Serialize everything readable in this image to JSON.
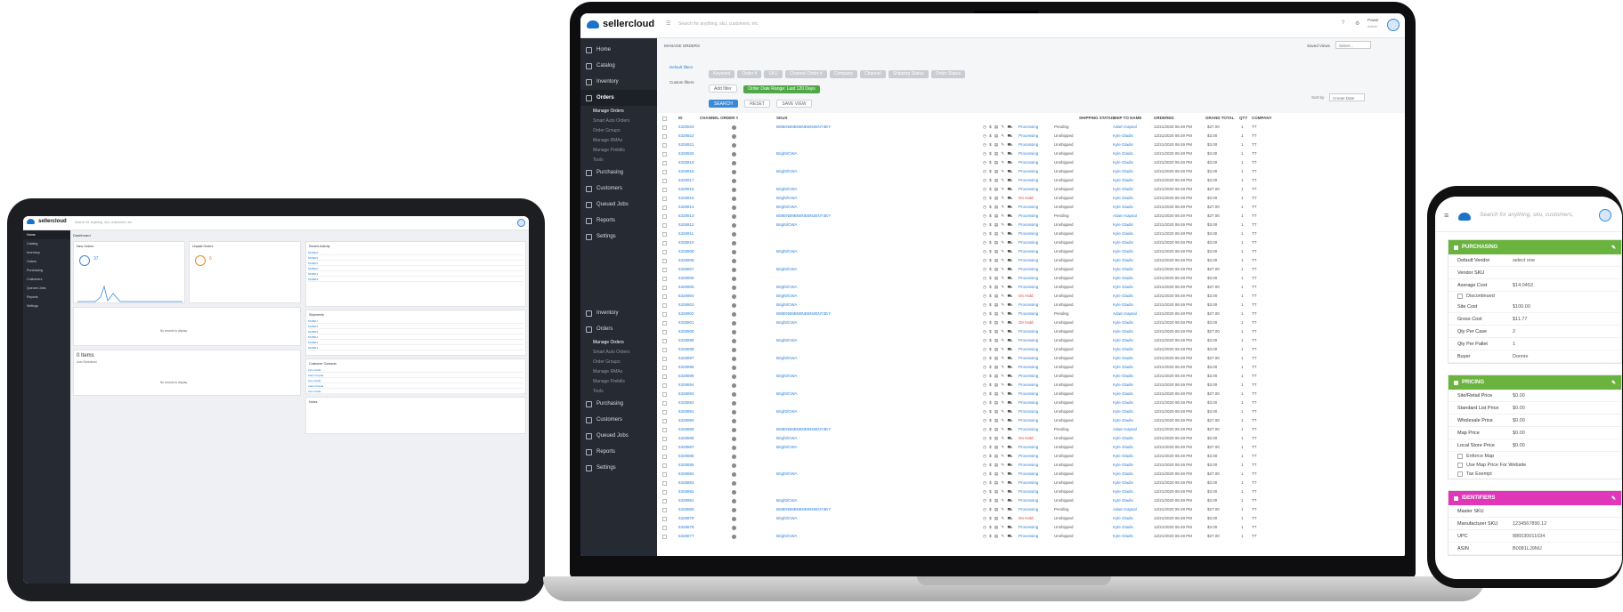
{
  "laptop": {
    "brand": "sellercloud",
    "search_placeholder": "Search for anything, sku, customers, etc",
    "user_name": "Power",
    "user_sub": "Admin",
    "sidebar": [
      {
        "label": "Home"
      },
      {
        "label": "Catalog"
      },
      {
        "label": "Inventory"
      },
      {
        "label": "Orders",
        "active": true,
        "subs": [
          "Manage Orders",
          "Smart Auto Orders",
          "Order Groups",
          "Manage RMAs",
          "Manage Prebills",
          "Tools"
        ]
      },
      {
        "label": "Purchasing"
      },
      {
        "label": "Customers"
      },
      {
        "label": "Queued Jobs"
      },
      {
        "label": "Reports"
      },
      {
        "label": "Settings"
      }
    ],
    "sidebar_repeat": [
      {
        "label": "Inventory"
      },
      {
        "label": "Orders",
        "subs": [
          "Manage Orders",
          "Smart Auto Orders",
          "Order Groups",
          "Manage RMAs",
          "Manage Prebills",
          "Tools"
        ]
      },
      {
        "label": "Purchasing"
      },
      {
        "label": "Customers"
      },
      {
        "label": "Queued Jobs"
      },
      {
        "label": "Reports"
      },
      {
        "label": "Settings"
      }
    ],
    "page_title": "MANAGE ORDERS",
    "saved_views_label": "Saved Views",
    "saved_views_value": "Select...",
    "default_filters_label": "Default filters",
    "filter_chips": [
      "Keyword",
      "Order #",
      "SKU",
      "Channel Order #",
      "Company",
      "Channel",
      "Shipping Status",
      "Order Status"
    ],
    "custom_filters_label": "Custom filters",
    "add_filter": "Add filter",
    "date_chip": "Order Date Range: Last 120 Days",
    "search_btn": "SEARCH",
    "reset_btn": "RESET",
    "save_view_btn": "SAVE VIEW",
    "sort_label": "Sort by",
    "sort_value": "Create Date",
    "columns": [
      "ID",
      "CHANNEL ORDER #",
      "SKUS",
      "SHIPPING STATUS",
      "SHIP TO NAME",
      "ORDERED",
      "GRAND TOTAL",
      "QTY",
      "COMPANY"
    ],
    "rows": [
      [
        "5328923",
        "",
        "B08ENB9BN8NEBN3ENY3EY",
        "Processing",
        "Pending",
        "Adam Kapsal",
        "12/21/2020 06:49 PM",
        "$27.00",
        "1",
        "TT"
      ],
      [
        "5328922",
        "",
        "",
        "Processing",
        "Unshipped",
        "Kyle Gladis",
        "12/21/2020 06:49 PM",
        "$3.00",
        "1",
        "TT"
      ],
      [
        "5328921",
        "",
        "",
        "Processing",
        "Unshipped",
        "Kyle Gladis",
        "12/21/2020 06:49 PM",
        "$3.00",
        "1",
        "TT"
      ],
      [
        "5328920",
        "",
        "Bright/CWA",
        "Processing",
        "Unshipped",
        "Kyle Gladis",
        "12/21/2020 06:49 PM",
        "$3.00",
        "1",
        "TT"
      ],
      [
        "5328919",
        "",
        "",
        "Processing",
        "Unshipped",
        "Kyle Gladis",
        "12/21/2020 06:49 PM",
        "$3.00",
        "1",
        "TT"
      ],
      [
        "5328918",
        "",
        "Bright/CWA",
        "Processing",
        "Unshipped",
        "Kyle Gladis",
        "12/21/2020 06:49 PM",
        "$3.00",
        "1",
        "TT"
      ],
      [
        "5328917",
        "",
        "",
        "Processing",
        "Unshipped",
        "Kyle Gladis",
        "12/21/2020 06:49 PM",
        "$3.00",
        "1",
        "TT"
      ],
      [
        "5328916",
        "",
        "Bright/CWA",
        "Processing",
        "Unshipped",
        "Kyle Gladis",
        "12/21/2020 06:49 PM",
        "$27.00",
        "1",
        "TT"
      ],
      [
        "5328915",
        "",
        "Bright/CWA",
        "On Hold",
        "Unshipped",
        "Kyle Gladis",
        "12/21/2020 06:49 PM",
        "$3.00",
        "1",
        "TT"
      ],
      [
        "5328914",
        "",
        "Bright/CWA",
        "Processing",
        "Unshipped",
        "Kyle Gladis",
        "12/21/2020 06:49 PM",
        "$27.00",
        "1",
        "TT"
      ],
      [
        "5328913",
        "",
        "B08ENB9BN8NEBN3ENY3EY",
        "Processing",
        "Pending",
        "Adam Kapsal",
        "12/21/2020 06:49 PM",
        "$27.00",
        "1",
        "TT"
      ],
      [
        "5328912",
        "",
        "Bright/CWA",
        "Processing",
        "Unshipped",
        "Kyle Gladis",
        "12/21/2020 06:49 PM",
        "$3.00",
        "1",
        "TT"
      ],
      [
        "5328911",
        "",
        "",
        "Processing",
        "Unshipped",
        "Kyle Gladis",
        "12/21/2020 06:49 PM",
        "$3.00",
        "1",
        "TT"
      ],
      [
        "5328910",
        "",
        "",
        "Processing",
        "Unshipped",
        "Kyle Gladis",
        "12/21/2020 06:49 PM",
        "$3.00",
        "1",
        "TT"
      ],
      [
        "5328909",
        "",
        "Bright/CWA",
        "Processing",
        "Unshipped",
        "Kyle Gladis",
        "12/21/2020 06:49 PM",
        "$3.00",
        "1",
        "TT"
      ],
      [
        "5328908",
        "",
        "",
        "Processing",
        "Unshipped",
        "Kyle Gladis",
        "12/21/2020 06:49 PM",
        "$3.00",
        "1",
        "TT"
      ],
      [
        "5328907",
        "",
        "Bright/CWA",
        "Processing",
        "Unshipped",
        "Kyle Gladis",
        "12/21/2020 06:49 PM",
        "$27.00",
        "1",
        "TT"
      ],
      [
        "5328906",
        "",
        "",
        "Processing",
        "Unshipped",
        "Kyle Gladis",
        "12/21/2020 06:49 PM",
        "$3.00",
        "1",
        "TT"
      ],
      [
        "5328905",
        "",
        "Bright/CWA",
        "Processing",
        "Unshipped",
        "Kyle Gladis",
        "12/21/2020 06:49 PM",
        "$27.00",
        "1",
        "TT"
      ],
      [
        "5328904",
        "",
        "Bright/CWA",
        "On Hold",
        "Unshipped",
        "Kyle Gladis",
        "12/21/2020 06:49 PM",
        "$3.00",
        "1",
        "TT"
      ],
      [
        "5328903",
        "",
        "Bright/CWA",
        "Processing",
        "Unshipped",
        "Kyle Gladis",
        "12/21/2020 06:49 PM",
        "$3.00",
        "1",
        "TT"
      ],
      [
        "5328902",
        "",
        "B08ENB9BN8NEBN3ENY3EY",
        "Processing",
        "Pending",
        "Adam Kapsal",
        "12/21/2020 06:49 PM",
        "$27.00",
        "1",
        "TT"
      ],
      [
        "5328901",
        "",
        "Bright/CWA",
        "On Hold",
        "Unshipped",
        "Kyle Gladis",
        "12/21/2020 06:49 PM",
        "$3.00",
        "1",
        "TT"
      ],
      [
        "5328900",
        "",
        "",
        "Processing",
        "Unshipped",
        "Kyle Gladis",
        "12/21/2020 06:49 PM",
        "$27.00",
        "1",
        "TT"
      ],
      [
        "5328899",
        "",
        "Bright/CWA",
        "Processing",
        "Unshipped",
        "Kyle Gladis",
        "12/21/2020 06:49 PM",
        "$3.00",
        "1",
        "TT"
      ],
      [
        "5328898",
        "",
        "",
        "Processing",
        "Unshipped",
        "Kyle Gladis",
        "12/21/2020 06:49 PM",
        "$3.00",
        "1",
        "TT"
      ],
      [
        "5328897",
        "",
        "Bright/CWA",
        "Processing",
        "Unshipped",
        "Kyle Gladis",
        "12/21/2020 06:49 PM",
        "$27.00",
        "1",
        "TT"
      ],
      [
        "5328896",
        "",
        "",
        "Processing",
        "Unshipped",
        "Kyle Gladis",
        "12/21/2020 06:49 PM",
        "$3.00",
        "1",
        "TT"
      ],
      [
        "5328895",
        "",
        "Bright/CWA",
        "Processing",
        "Unshipped",
        "Kyle Gladis",
        "12/21/2020 06:49 PM",
        "$3.00",
        "1",
        "TT"
      ],
      [
        "5328894",
        "",
        "",
        "Processing",
        "Unshipped",
        "Kyle Gladis",
        "12/21/2020 06:49 PM",
        "$3.00",
        "1",
        "TT"
      ],
      [
        "5328893",
        "",
        "Bright/CWA",
        "Processing",
        "Unshipped",
        "Kyle Gladis",
        "12/21/2020 06:49 PM",
        "$27.00",
        "1",
        "TT"
      ],
      [
        "5328892",
        "",
        "",
        "Processing",
        "Unshipped",
        "Kyle Gladis",
        "12/21/2020 06:49 PM",
        "$3.00",
        "1",
        "TT"
      ],
      [
        "5328891",
        "",
        "Bright/CWA",
        "Processing",
        "Unshipped",
        "Kyle Gladis",
        "12/21/2020 06:49 PM",
        "$3.00",
        "1",
        "TT"
      ],
      [
        "5328890",
        "",
        "",
        "Processing",
        "Unshipped",
        "Kyle Gladis",
        "12/21/2020 06:49 PM",
        "$27.00",
        "1",
        "TT"
      ],
      [
        "5328889",
        "",
        "B08ENB9BN8NEBN3ENY3EY",
        "Processing",
        "Pending",
        "Adam Kapsal",
        "12/21/2020 06:49 PM",
        "$27.00",
        "1",
        "TT"
      ],
      [
        "5328888",
        "",
        "Bright/CWA",
        "On Hold",
        "Unshipped",
        "Kyle Gladis",
        "12/21/2020 06:49 PM",
        "$3.00",
        "1",
        "TT"
      ],
      [
        "5328887",
        "",
        "Bright/CWA",
        "Processing",
        "Unshipped",
        "Kyle Gladis",
        "12/21/2020 06:49 PM",
        "$27.00",
        "1",
        "TT"
      ],
      [
        "5328886",
        "",
        "",
        "Processing",
        "Unshipped",
        "Kyle Gladis",
        "12/21/2020 06:49 PM",
        "$3.00",
        "1",
        "TT"
      ],
      [
        "5328885",
        "",
        "",
        "Processing",
        "Unshipped",
        "Kyle Gladis",
        "12/21/2020 06:49 PM",
        "$3.00",
        "1",
        "TT"
      ],
      [
        "5328884",
        "",
        "Bright/CWA",
        "Processing",
        "Unshipped",
        "Kyle Gladis",
        "12/21/2020 06:49 PM",
        "$27.00",
        "1",
        "TT"
      ],
      [
        "5328883",
        "",
        "",
        "Processing",
        "Unshipped",
        "Kyle Gladis",
        "12/21/2020 06:49 PM",
        "$3.00",
        "1",
        "TT"
      ],
      [
        "5328882",
        "",
        "",
        "Processing",
        "Unshipped",
        "Kyle Gladis",
        "12/21/2020 06:49 PM",
        "$3.00",
        "1",
        "TT"
      ],
      [
        "5328881",
        "",
        "Bright/CWA",
        "Processing",
        "Unshipped",
        "Kyle Gladis",
        "12/21/2020 06:49 PM",
        "$3.00",
        "1",
        "TT"
      ],
      [
        "5328880",
        "",
        "B08ENB9BN8NEBN3ENY3EY",
        "Processing",
        "Pending",
        "Adam Kapsal",
        "12/21/2020 06:49 PM",
        "$27.00",
        "1",
        "TT"
      ],
      [
        "5328879",
        "",
        "Bright/CWA",
        "On Hold",
        "Unshipped",
        "Kyle Gladis",
        "12/21/2020 06:49 PM",
        "$3.00",
        "1",
        "TT"
      ],
      [
        "5328878",
        "",
        "",
        "Processing",
        "Unshipped",
        "Kyle Gladis",
        "12/21/2020 06:49 PM",
        "$3.00",
        "1",
        "TT"
      ],
      [
        "5328877",
        "",
        "Bright/CWA",
        "Processing",
        "Unshipped",
        "Kyle Gladis",
        "12/21/2020 06:49 PM",
        "$27.00",
        "1",
        "TT"
      ]
    ]
  },
  "tablet": {
    "brand": "sellercloud",
    "search_placeholder": "Search for anything, sku, customers, etc",
    "dashboard_title": "Dashboard",
    "sidebar": [
      "Home",
      "Catalog",
      "Inventory",
      "Orders",
      "Purchasing",
      "Customers",
      "Queued Jobs",
      "Reports",
      "Settings"
    ],
    "widget1_title": "New Orders",
    "widget1_value": "37",
    "widget2_title": "Unpaid Orders",
    "widget2_value": "6",
    "no_records": "No records to display",
    "items_title": "0 Items",
    "items_sub": "Auto Scheduled",
    "recent_title": "Recent Activity",
    "recent_rows": [
      "5328923",
      "5328922",
      "5328921",
      "5328920",
      "5328919",
      "5328918"
    ],
    "shipment_title": "Shipments",
    "ship_rows": [
      "5328917",
      "5328916",
      "5328915",
      "5328914",
      "5328913",
      "5328912"
    ],
    "contacts_title": "Customer Contacts",
    "contact_rows": [
      "Kyle Gladis",
      "Adam Kapsal",
      "Kyle Gladis",
      "Adam Kapsal",
      "Kyle Gladis"
    ],
    "notes_title": "Notes"
  },
  "phone": {
    "search_placeholder": "Search for anything, sku, customers,",
    "sections": [
      {
        "title": "PURCHASING",
        "color": "#6ab33e",
        "fields": [
          [
            "Default Vendor",
            "select one"
          ],
          [
            "Vendor SKU",
            ""
          ],
          [
            "Average Cost",
            "$14.0453"
          ]
        ],
        "checks": [
          "Discontinued"
        ],
        "fields2": [
          [
            "Site Cost",
            "$100.00"
          ],
          [
            "Gross Cost",
            "$11.77"
          ],
          [
            "Qty Per Case",
            "2"
          ],
          [
            "Qty Per Pallet",
            "1"
          ],
          [
            "Buyer",
            "Donnie"
          ]
        ]
      },
      {
        "title": "PRICING",
        "color": "#6ab33e",
        "fields": [
          [
            "Site/Retail Price",
            "$0.00"
          ],
          [
            "Standard List Price",
            "$0.00"
          ],
          [
            "Wholesale Price",
            "$0.00"
          ],
          [
            "Map Price",
            "$0.00"
          ],
          [
            "Local Store Price",
            "$0.00"
          ]
        ],
        "checks": [
          "Enforce Map",
          "Use Map Price For Website",
          "Tax Exempt"
        ]
      },
      {
        "title": "IDENTIFIERS",
        "color": "#e037b8",
        "fields": [
          [
            "Master SKU",
            ""
          ],
          [
            "Manufacturer SKU",
            "1234567890.12"
          ],
          [
            "UPC",
            "886030011034"
          ],
          [
            "ASIN",
            "B0081LJ9NU"
          ]
        ]
      }
    ]
  }
}
